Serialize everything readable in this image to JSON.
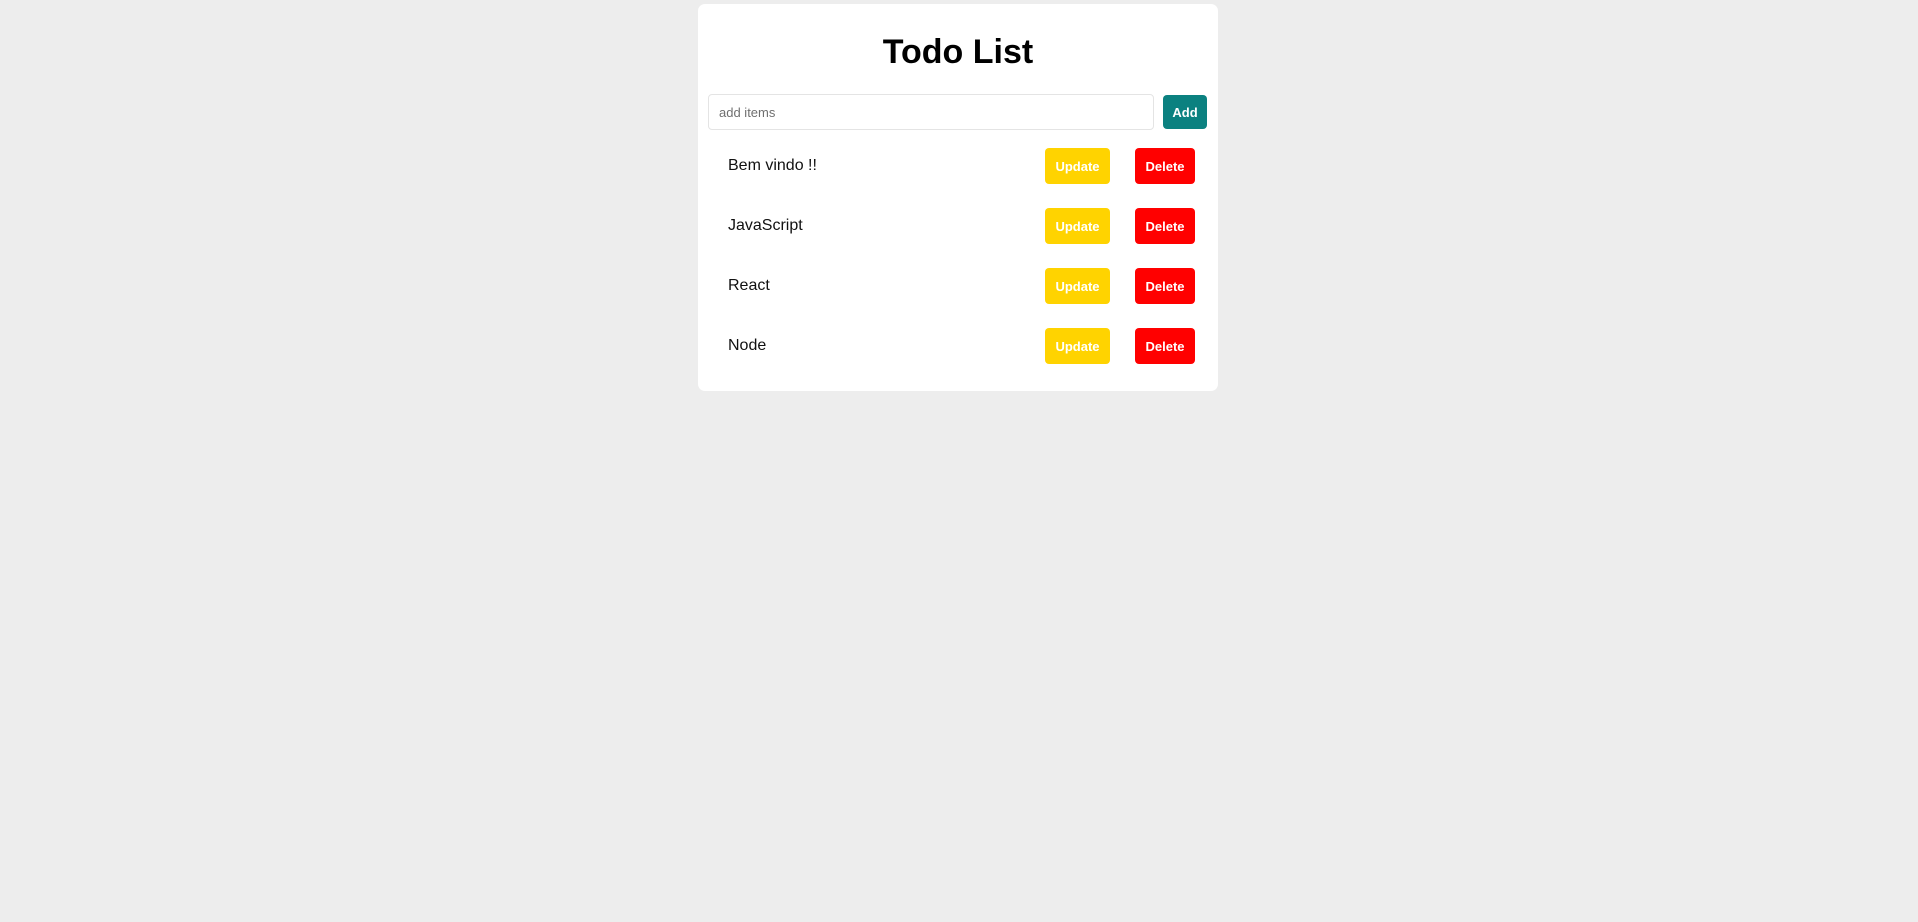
{
  "title": "Todo List",
  "input": {
    "placeholder": "add items",
    "value": ""
  },
  "add_label": "Add",
  "items": [
    {
      "text": "Bem vindo !!",
      "update_label": "Update",
      "delete_label": "Delete"
    },
    {
      "text": "JavaScript",
      "update_label": "Update",
      "delete_label": "Delete"
    },
    {
      "text": "React",
      "update_label": "Update",
      "delete_label": "Delete"
    },
    {
      "text": "Node",
      "update_label": "Update",
      "delete_label": "Delete"
    }
  ],
  "colors": {
    "page_bg": "#ededed",
    "card_bg": "#ffffff",
    "add_button": "#0b8180",
    "update_button": "#ffd300",
    "delete_button": "#ff0000"
  }
}
